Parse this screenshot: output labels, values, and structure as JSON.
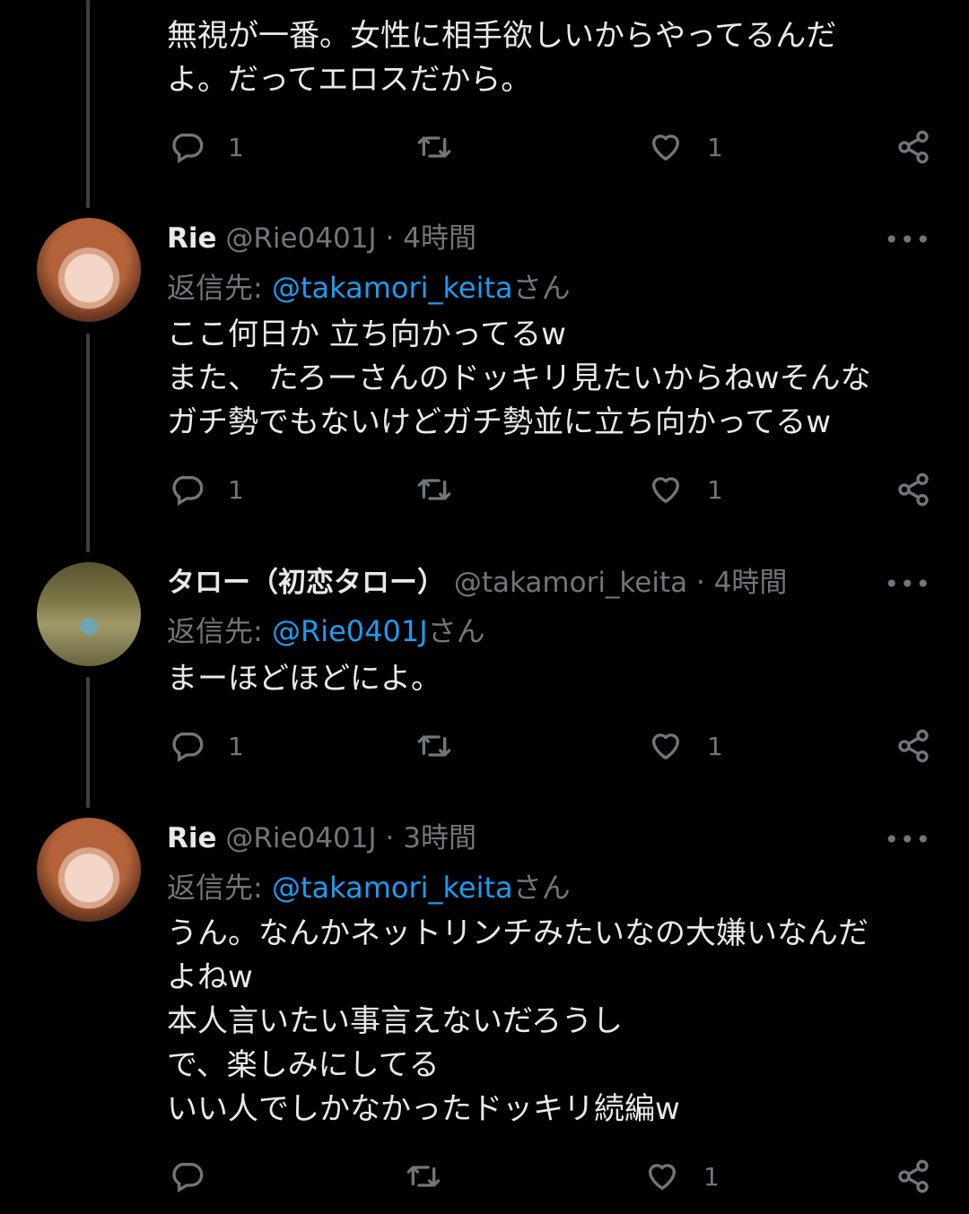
{
  "tweets": [
    {
      "name": "",
      "handle": "",
      "time": "",
      "reply_prefix": "",
      "reply_mention": "",
      "reply_suffix": "",
      "lines": [
        "無視が一番。女性に相手欲しいからやってるんだ",
        "よ。だってエロスだから。"
      ],
      "reply_count": "1",
      "retweet_count": "",
      "like_count": "1"
    },
    {
      "name": "Rie",
      "handle": "@Rie0401J",
      "dot": "·",
      "time": "4時間",
      "reply_prefix": "返信先: ",
      "reply_mention": "@takamori_keita",
      "reply_suffix": "さん",
      "lines": [
        "ここ何日か 立ち向かってるw",
        "また、 たろーさんのドッキリ見たいからねwそんな",
        "ガチ勢でもないけどガチ勢並に立ち向かってるw"
      ],
      "reply_count": "1",
      "retweet_count": "",
      "like_count": "1"
    },
    {
      "name": "タロー（初恋タロー）",
      "handle": "@takamori_keita",
      "dot": "·",
      "time": "4時間",
      "reply_prefix": "返信先: ",
      "reply_mention": "@Rie0401J",
      "reply_suffix": "さん",
      "lines": [
        "まーほどほどによ。"
      ],
      "reply_count": "1",
      "retweet_count": "",
      "like_count": "1"
    },
    {
      "name": "Rie",
      "handle": "@Rie0401J",
      "dot": "·",
      "time": "3時間",
      "reply_prefix": "返信先: ",
      "reply_mention": "@takamori_keita",
      "reply_suffix": "さん",
      "lines": [
        "うん。なんかネットリンチみたいなの大嫌いなんだ",
        "よねw",
        "本人言いたい事言えないだろうし",
        "で、楽しみにしてる",
        "いい人でしかなかったドッキリ続編w"
      ],
      "reply_count": "",
      "retweet_count": "",
      "like_count": "1"
    }
  ],
  "icons": {
    "reply": "speech-bubble-icon",
    "retweet": "retweet-arrows-icon",
    "like": "heart-icon",
    "share": "share-nodes-icon",
    "more": "more-dots-icon"
  },
  "colors": {
    "background": "#000000",
    "text": "#e7e9ea",
    "muted": "#71767b",
    "link": "#1d9bf0",
    "thread_line": "#3e4144"
  },
  "more_glyph": "•••"
}
